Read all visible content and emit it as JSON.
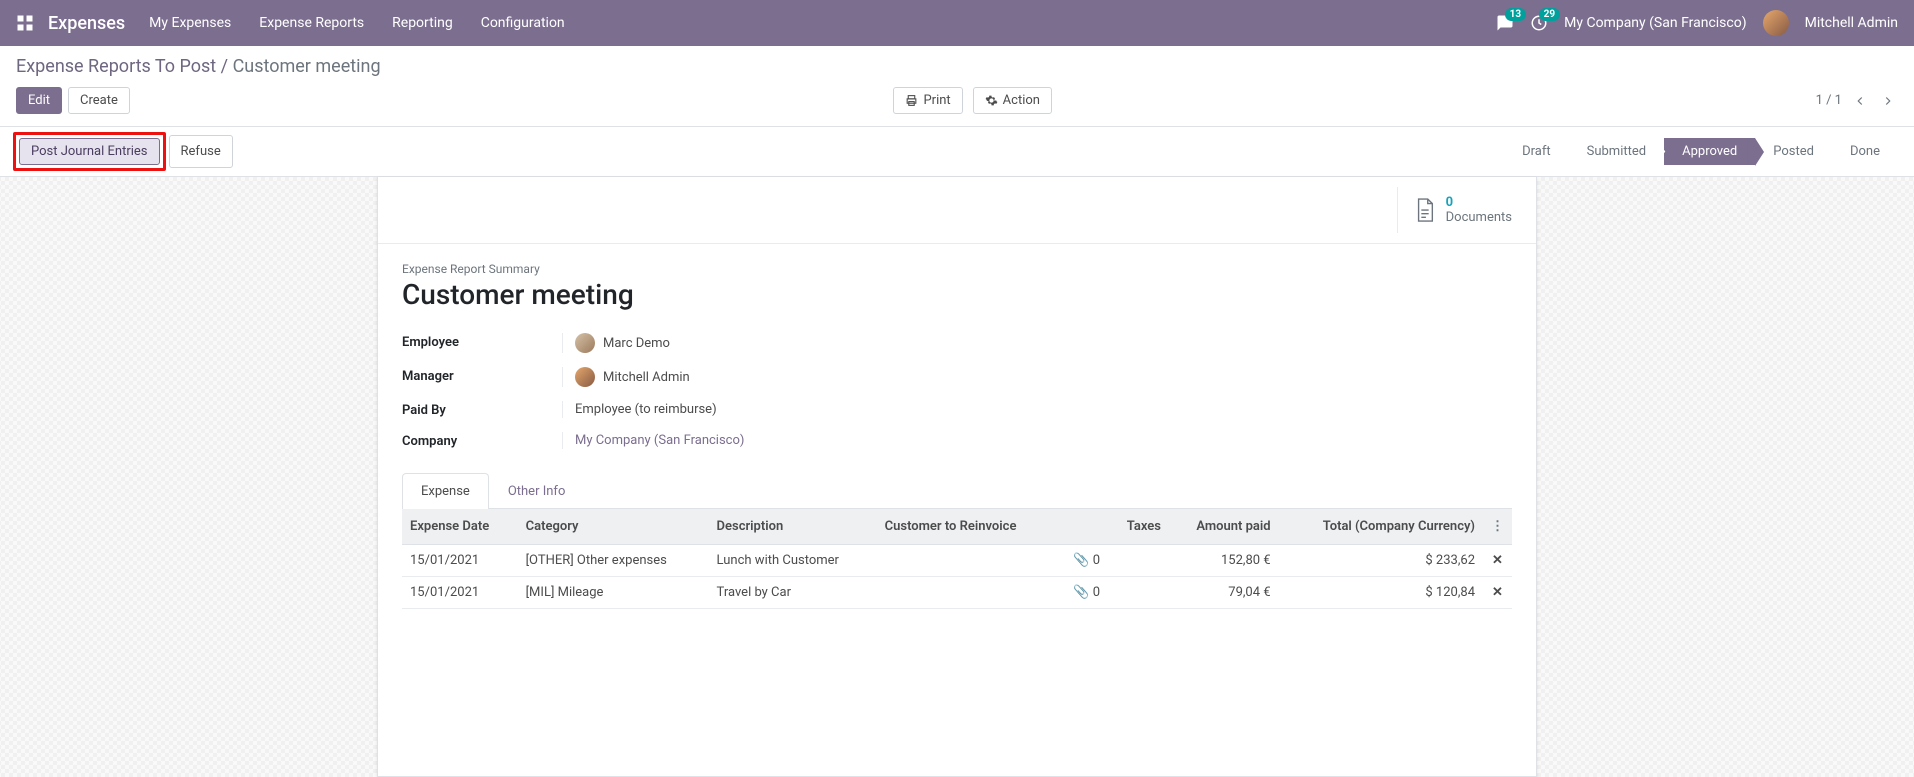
{
  "nav": {
    "brand": "Expenses",
    "menu": [
      "My Expenses",
      "Expense Reports",
      "Reporting",
      "Configuration"
    ],
    "chat_badge": "13",
    "activity_badge": "29",
    "company": "My Company (San Francisco)",
    "user": "Mitchell Admin"
  },
  "breadcrumb": {
    "parent": "Expense Reports To Post",
    "current": "Customer meeting"
  },
  "toolbar": {
    "edit": "Edit",
    "create": "Create",
    "print": "Print",
    "action": "Action",
    "pager": "1 / 1"
  },
  "statusbar": {
    "post": "Post Journal Entries",
    "refuse": "Refuse",
    "steps": [
      "Draft",
      "Submitted",
      "Approved",
      "Posted",
      "Done"
    ],
    "active_index": 2
  },
  "docs": {
    "count": "0",
    "label": "Documents"
  },
  "summary": {
    "label": "Expense Report Summary",
    "title": "Customer meeting",
    "fields": {
      "employee_label": "Employee",
      "employee": "Marc Demo",
      "manager_label": "Manager",
      "manager": "Mitchell Admin",
      "paidby_label": "Paid By",
      "paidby": "Employee (to reimburse)",
      "company_label": "Company",
      "company": "My Company (San Francisco)"
    }
  },
  "tabs": {
    "expense": "Expense",
    "other": "Other Info"
  },
  "table": {
    "headers": {
      "date": "Expense Date",
      "category": "Category",
      "desc": "Description",
      "cust": "Customer to Reinvoice",
      "attach": "",
      "taxes": "Taxes",
      "amount": "Amount paid",
      "total": "Total (Company Currency)"
    },
    "rows": [
      {
        "date": "15/01/2021",
        "category": "[OTHER] Other expenses",
        "desc": "Lunch with Customer",
        "cust": "",
        "attach": "0",
        "taxes": "",
        "amount": "152,80 €",
        "total": "$ 233,62"
      },
      {
        "date": "15/01/2021",
        "category": "[MIL] Mileage",
        "desc": "Travel by Car",
        "cust": "",
        "attach": "0",
        "taxes": "",
        "amount": "79,04 €",
        "total": "$ 120,84"
      }
    ]
  }
}
